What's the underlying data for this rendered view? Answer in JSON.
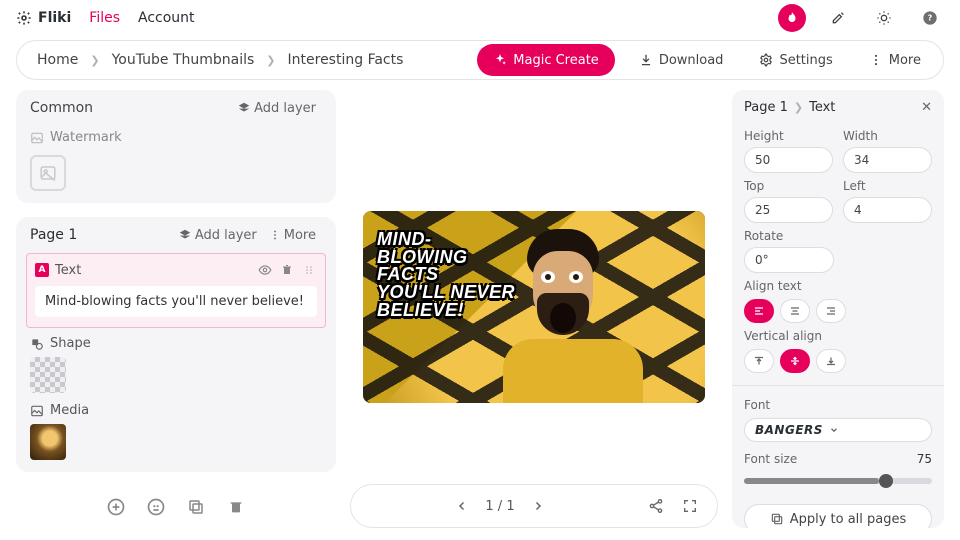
{
  "topbar": {
    "brand": "Fliki",
    "files": "Files",
    "account": "Account",
    "active": "files"
  },
  "crumbs": {
    "home": "Home",
    "folder": "YouTube Thumbnails",
    "file": "Interesting Facts"
  },
  "actions": {
    "magic": "Magic Create",
    "download": "Download",
    "settings": "Settings",
    "more": "More"
  },
  "left": {
    "common": {
      "title": "Common",
      "addlayer": "Add layer",
      "watermark": "Watermark"
    },
    "page1": {
      "title": "Page 1",
      "addlayer": "Add layer",
      "more": "More",
      "textLabel": "Text",
      "textValue": "Mind-blowing facts you'll never believe!",
      "shape": "Shape",
      "media": "Media"
    }
  },
  "canvas": {
    "thumbText": "Mind-\nblowing\nfacts\nyou'll never\nbelieve!",
    "page": "1 / 1"
  },
  "right": {
    "crumb1": "Page 1",
    "crumb2": "Text",
    "height": {
      "label": "Height",
      "value": "50"
    },
    "width": {
      "label": "Width",
      "value": "34"
    },
    "top": {
      "label": "Top",
      "value": "25"
    },
    "left": {
      "label": "Left",
      "value": "4"
    },
    "rotate": {
      "label": "Rotate",
      "value": "0°"
    },
    "alignText": "Align text",
    "valign": "Vertical align",
    "font": {
      "label": "Font",
      "value": "BANGERS"
    },
    "fontSize": {
      "label": "Font size",
      "value": "75"
    },
    "apply": "Apply to all pages"
  }
}
